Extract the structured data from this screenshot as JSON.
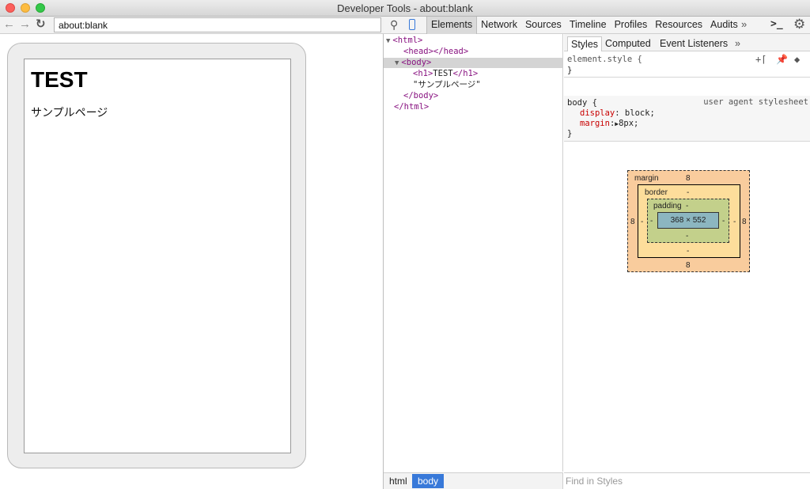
{
  "window": {
    "title": "Developer Tools - about:blank"
  },
  "browser": {
    "url": "about:blank",
    "page": {
      "heading": "TEST",
      "paragraph": "サンプルページ"
    }
  },
  "devtools": {
    "tabs": [
      "Elements",
      "Network",
      "Sources",
      "Timeline",
      "Profiles",
      "Resources",
      "Audits"
    ],
    "active_tab": "Elements",
    "more_label": "»",
    "tree": {
      "html_open": "<html>",
      "head": "<head></head>",
      "body_open": "<body>",
      "h1_open": "<h1>",
      "h1_text": "TEST",
      "h1_close": "</h1>",
      "text_node": "\"サンプルページ\"",
      "body_close": "</body>",
      "html_close": "</html>"
    },
    "breadcrumbs": {
      "html": "html",
      "body": "body"
    },
    "styles_tabs": {
      "styles": "Styles",
      "computed": "Computed",
      "events": "Event Listeners",
      "more": "»"
    },
    "element_style": {
      "selector": "element.style {",
      "close": "}"
    },
    "body_rule": {
      "selector": "body {",
      "source": "user agent stylesheet",
      "p1_name": "display",
      "p1_value": "block;",
      "p2_name": "margin",
      "p2_value": "8px;",
      "close": "}"
    },
    "box_model": {
      "margin_label": "margin",
      "margin_top": "8",
      "margin_bottom": "8",
      "margin_left": "8",
      "margin_right": "8",
      "border_label": "border",
      "border_top": "-",
      "border_bottom": "-",
      "border_left": "-",
      "border_right": "-",
      "padding_label": "padding",
      "padding_top": "-",
      "padding_bottom": "-",
      "padding_left": "-",
      "padding_right": "-",
      "content": "368 × 552"
    },
    "find_placeholder": "Find in Styles"
  },
  "colors": {
    "selected_crumb": "#3879d9",
    "tag": "#881280",
    "prop": "#c80000"
  }
}
